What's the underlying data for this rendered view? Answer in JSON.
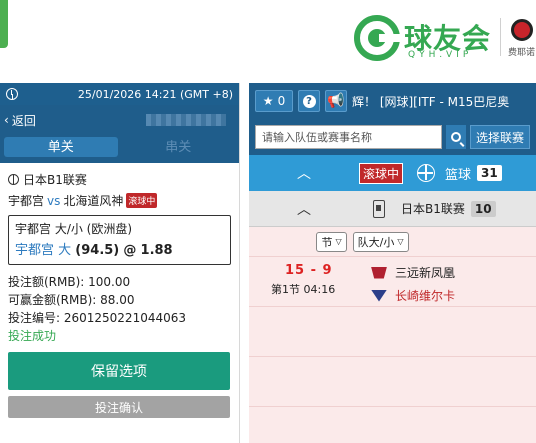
{
  "brand": {
    "logo_text": "球友会",
    "logo_sub": "QYH.VIP",
    "sponsor_text": "费耶诺"
  },
  "bet_panel": {
    "datetime": "25/01/2026 14:21 (GMT +8)",
    "back_label": "返回",
    "tabs": [
      "单关",
      "串关"
    ],
    "league": "日本B1联赛",
    "home_team": "宇都宫",
    "vs": "vs",
    "away_team": "北海道风神",
    "live_label": "滚球中",
    "market": "宇都宫 大/小 (欧洲盘)",
    "pick_team": "宇都宫 大",
    "pick_line": "(94.5)",
    "pick_at": "@",
    "pick_odds": "1.88",
    "stake": "投注额(RMB): 100.00",
    "win_amount": "可赢金额(RMB): 88.00",
    "bet_id": "投注编号: 2601250221044063",
    "status": "投注成功",
    "keep_button": "保留选项",
    "confirm_button": "投注确认"
  },
  "main": {
    "fav_count": "0",
    "help_icon": "?",
    "marquee": "辉！    [网球][ITF - M15巴尼奥",
    "search_placeholder": "请输入队伍或赛事名称",
    "select_league_label": "选择联赛",
    "sport_live_label": "滚球中",
    "sport_name": "篮球",
    "sport_count": "31",
    "league_name": "日本B1联赛",
    "league_count": "10",
    "filters": [
      "节",
      "队大/小"
    ],
    "game": {
      "score": "15 - 9",
      "period": "第1节 04:16",
      "home": "三远新凤凰",
      "away": "长崎维尔卡"
    }
  },
  "colors": {
    "header_blue": "#1f5d8b",
    "sport_bar": "#2f9bd6",
    "brand_green": "#35a852",
    "keep_button": "#1a9b7e",
    "live_red": "#c0282a",
    "list_bg": "#fbeaea"
  }
}
